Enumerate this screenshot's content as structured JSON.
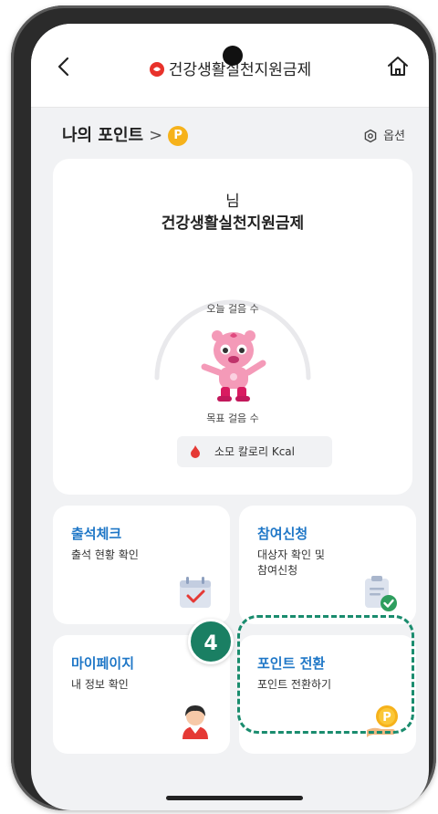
{
  "app": {
    "title": "건강생활실천지원금제",
    "accent_color": "#1f77c7",
    "logo_color": "#e8322b"
  },
  "header": {
    "my_points_label": "나의 포인트",
    "chevron": ">",
    "points_badge": "P",
    "options_label": "옵션"
  },
  "summary": {
    "user_suffix": "님",
    "program_name": "건강생활실천지원금제",
    "today_steps_label": "오늘 걸음 수",
    "goal_steps_label": "목표 걸음 수",
    "calories_label": "소모 칼로리 Kcal"
  },
  "menu": {
    "attendance": {
      "title": "출석체크",
      "desc": "출석 현황 확인",
      "icon": "calendar-check-icon"
    },
    "apply": {
      "title": "참여신청",
      "desc_line1": "대상자 확인 및",
      "desc_line2": "참여신청",
      "icon": "clipboard-check-icon"
    },
    "mypage": {
      "title": "마이페이지",
      "desc": "내 정보 확인",
      "icon": "person-icon"
    },
    "convert": {
      "title": "포인트 전환",
      "desc": "포인트 전환하기",
      "icon": "point-coin-hand-icon"
    }
  },
  "guide": {
    "step_number": "4",
    "highlight_color": "#1a8c6e"
  }
}
